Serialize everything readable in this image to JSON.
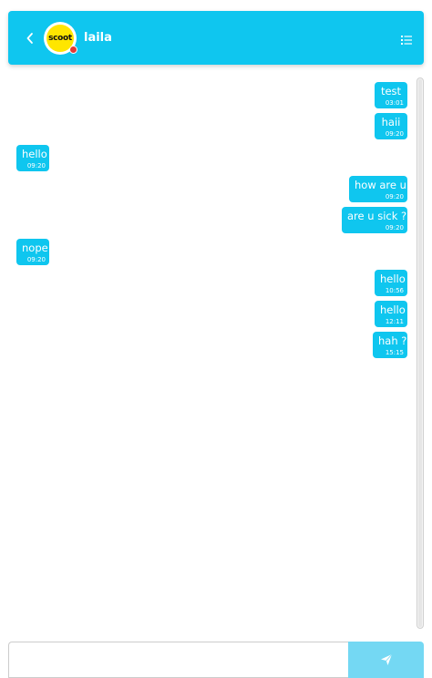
{
  "header": {
    "contact_name": "laila",
    "avatar_text": "scoot",
    "status_color": "#e53935",
    "accent_color": "#0fc6ef",
    "icons": {
      "back": "chevron-left-icon",
      "menu": "list-icon"
    }
  },
  "messages": [
    {
      "text": "test",
      "time": "03:01",
      "side": "right"
    },
    {
      "text": "haii",
      "time": "09:20",
      "side": "right"
    },
    {
      "text": "hello",
      "time": "09:20",
      "side": "left"
    },
    {
      "text": "how are u",
      "time": "09:20",
      "side": "right"
    },
    {
      "text": "are u sick ?",
      "time": "09:20",
      "side": "right"
    },
    {
      "text": "nope",
      "time": "09:20",
      "side": "left"
    },
    {
      "text": "hello",
      "time": "10:56",
      "side": "right"
    },
    {
      "text": "hello",
      "time": "12:11",
      "side": "right"
    },
    {
      "text": "hah ?",
      "time": "15:15",
      "side": "right"
    }
  ],
  "composer": {
    "value": "",
    "placeholder": "",
    "send_icon": "paper-plane-icon"
  }
}
